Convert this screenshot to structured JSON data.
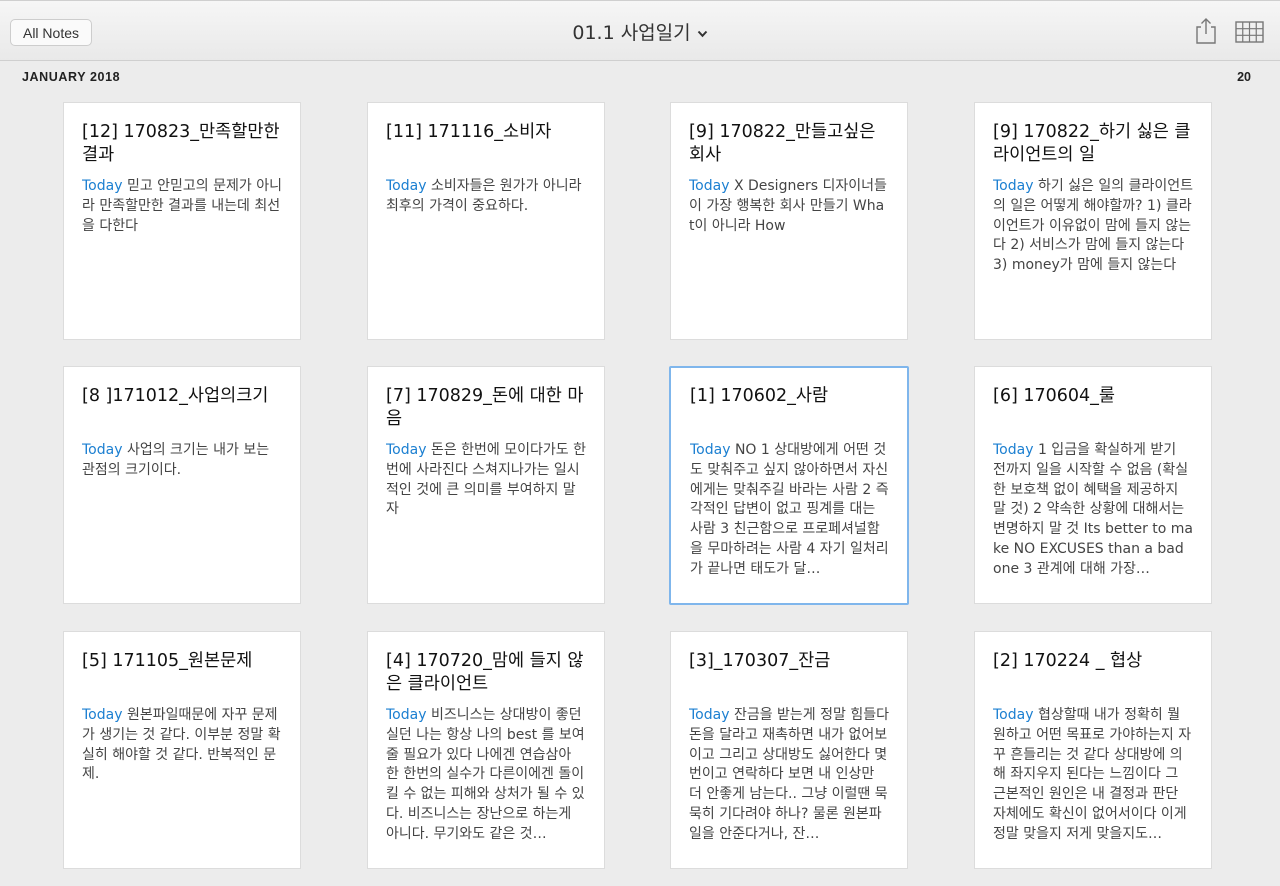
{
  "toolbar": {
    "all_notes_label": "All Notes",
    "notebook_title": "01.1 사업일기",
    "icons": [
      "share-icon",
      "grid-view-icon",
      "chevron-down-icon"
    ]
  },
  "section": {
    "month": "JANUARY 2018",
    "count": "20"
  },
  "accent_color": "#1b7fd1",
  "selected_border_color": "#7fb6ec",
  "notes": [
    {
      "title": "[12] 170823_만족할만한 결과",
      "date": "Today",
      "snippet": "믿고 안믿고의 문제가 아니라 만족할만한 결과를 내는데 최선을 다한다"
    },
    {
      "title": "[11] 171116_소비자",
      "date": "Today",
      "snippet": "소비자들은 원가가 아니라 최후의 가격이 중요하다."
    },
    {
      "title": "[9] 170822_만들고싶은 회사",
      "date": "Today",
      "snippet": "X Designers 디자이너들이 가장 행복한 회사 만들기 What이 아니라 How"
    },
    {
      "title": "[9] 170822_하기 싫은 클라이언트의 일",
      "date": "Today",
      "snippet": "하기 싫은 일의 클라이언트의 일은 어떻게 해야할까? 1) 클라이언트가 이유없이 맘에 들지 않는다 2) 서비스가 맘에 들지 않는다 3) money가 맘에 들지 않는다"
    },
    {
      "title": "[8 ]171012_사업의크기",
      "date": "Today",
      "snippet": "사업의 크기는 내가 보는 관점의 크기이다."
    },
    {
      "title": "[7] 170829_돈에 대한 마음",
      "date": "Today",
      "snippet": "돈은 한번에 모이다가도 한번에 사라진다 스쳐지나가는 일시적인 것에 큰 의미를 부여하지 말자"
    },
    {
      "title": "[1] 170602_사람",
      "date": "Today",
      "snippet": "NO 1 상대방에게 어떤 것도 맞춰주고 싶지 않아하면서 자신에게는 맞춰주길 바라는 사람 2 즉각적인 답변이 없고 핑계를 대는 사람 3 친근함으로 프로페셔널함을 무마하려는 사람 4 자기 일처리가 끝나면 태도가 달…"
    },
    {
      "title": "[6] 170604_룰",
      "date": "Today",
      "snippet": "1 입금을 확실하게 받기 전까지 일을 시작할 수 없음 (확실한 보호책 없이 혜택을 제공하지 말 것) 2 약속한 상황에 대해서는 변명하지 말 것 Its better to make NO EXCUSES than a bad one 3 관계에 대해 가장…"
    },
    {
      "title": "[5] 171105_원본문제",
      "date": "Today",
      "snippet": "원본파일때문에 자꾸 문제가 생기는 것 같다. 이부분 정말 확실히 해야할 것 같다. 반복적인 문제."
    },
    {
      "title": "[4] 170720_맘에 들지 않은 클라이언트",
      "date": "Today",
      "snippet": "비즈니스는 상대방이 좋던 실던 나는 항상 나의 best 를 보여줄 필요가 있다 나에겐 연습삼아 한 한번의 실수가 다른이에겐 돌이킬 수 없는 피해와 상처가 될 수 있다. 비즈니스는 장난으로 하는게 아니다. 무기와도 같은 것…"
    },
    {
      "title": "[3]_170307_잔금",
      "date": "Today",
      "snippet": "잔금을 받는게 정말 힘들다 돈을 달라고 재촉하면 내가 없어보이고 그리고 상대방도 싫어한다 몇번이고 연락하다 보면 내 인상만 더 안좋게 남는다.. 그냥 이럴땐 묵묵히 기다려야 하나? 물론 원본파일을 안준다거나, 잔…"
    },
    {
      "title": "[2] 170224 _ 협상",
      "date": "Today",
      "snippet": "협상할때 내가 정확히 뭘 원하고 어떤 목표로 가야하는지 자꾸 흔들리는 것 같다 상대방에 의해 좌지우지 된다는 느낌이다 그 근본적인 원인은 내 결정과 판단 자체에도 확신이 없어서이다 이게 정말 맞을지 저게 맞을지도…"
    }
  ]
}
